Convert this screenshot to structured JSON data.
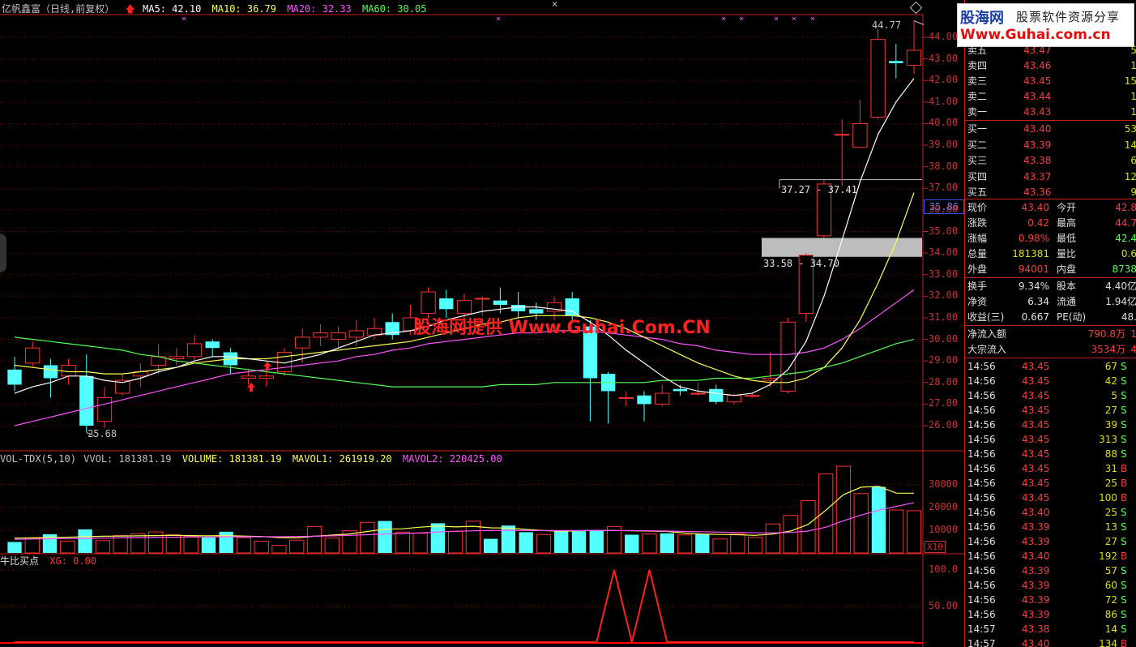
{
  "header": {
    "stock": "亿帆鑫富（日线,前复权）",
    "ma5": "MA5: 42.10",
    "ma10": "MA10: 36.79",
    "ma20": "MA20: 32.33",
    "ma60": "MA60: 30.05"
  },
  "colors": {
    "up": "#ff3232",
    "down": "#54ffff",
    "ma5": "#ffffff",
    "ma10": "#ffff54",
    "ma20": "#ff54ff",
    "ma60": "#54ff54",
    "grid": "#8b0000"
  },
  "icons": [
    "up-arrow-icon",
    "close-icon",
    "restore-icon"
  ],
  "price_axis": [
    "44.00",
    "43.00",
    "42.00",
    "41.00",
    "40.00",
    "39.00",
    "38.00",
    "37.00",
    "36.00",
    "35.00",
    "34.00",
    "33.00",
    "32.00",
    "31.00",
    "30.00",
    "29.00",
    "28.00",
    "27.00",
    "26.00"
  ],
  "current_price_tag": "35.86",
  "annotations": {
    "high": "44.77",
    "low": "25.68",
    "range_upper": "37.27 - 37.41",
    "range_lower": "33.58 - 34.70"
  },
  "watermark": "股海网提供 Www.Guhai.Com.CN",
  "logo": {
    "brand": "股海网",
    "slogan": "股票软件资源分享",
    "url": "Www.Guhai.com.cn"
  },
  "volume_panel": {
    "label": "VOL-TDX(5,10)",
    "vvol": "VVOL: 181381.19",
    "volume": "VOLUME: 181381.19",
    "mavol1": "MAVOL1: 261919.20",
    "mavol2": "MAVOL2: 220425.00",
    "axis": [
      "30000",
      "20000",
      "10000"
    ],
    "unit": "X10"
  },
  "indicator_panel": {
    "name": "牛比买点",
    "xg": "XG: 0.00",
    "axis": [
      "100.0",
      "50.00"
    ]
  },
  "chart_data": {
    "type": "candlestick",
    "ylim": [
      25.0,
      45.5
    ],
    "candles": [
      [
        28.6,
        27.9,
        29.2,
        27.6
      ],
      [
        28.9,
        29.6,
        29.9,
        28.7
      ],
      [
        28.8,
        28.2,
        29.1,
        27.3
      ],
      [
        28.3,
        28.8,
        29.1,
        27.9
      ],
      [
        28.3,
        26.0,
        29.3,
        25.7
      ],
      [
        26.2,
        27.3,
        27.8,
        25.9
      ],
      [
        27.5,
        28.1,
        28.4,
        27.4
      ],
      [
        28.3,
        28.5,
        28.9,
        27.8
      ],
      [
        28.8,
        29.2,
        29.8,
        28.4
      ],
      [
        29.1,
        29.2,
        29.6,
        28.8
      ],
      [
        29.2,
        29.8,
        30.2,
        28.9
      ],
      [
        29.9,
        29.6,
        30.0,
        29.2
      ],
      [
        29.4,
        28.8,
        29.6,
        28.4
      ],
      [
        28.2,
        28.3,
        28.6,
        27.9
      ],
      [
        28.2,
        28.3,
        28.6,
        27.8
      ],
      [
        28.5,
        29.4,
        29.6,
        28.3
      ],
      [
        29.6,
        30.1,
        30.5,
        28.9
      ],
      [
        30.1,
        30.3,
        30.7,
        29.7
      ],
      [
        30.0,
        30.3,
        30.6,
        29.6
      ],
      [
        30.1,
        30.4,
        30.9,
        29.7
      ],
      [
        30.2,
        30.5,
        31.0,
        30.0
      ],
      [
        30.8,
        30.2,
        31.2,
        30.0
      ],
      [
        30.4,
        31.0,
        31.6,
        30.2
      ],
      [
        31.2,
        32.2,
        32.4,
        31.0
      ],
      [
        31.9,
        31.4,
        32.3,
        31.0
      ],
      [
        31.2,
        31.8,
        32.1,
        30.8
      ],
      [
        31.9,
        31.9,
        32.0,
        31.1
      ],
      [
        31.8,
        31.6,
        32.4,
        31.2
      ],
      [
        31.6,
        31.3,
        32.2,
        31.0
      ],
      [
        31.4,
        31.2,
        31.7,
        30.9
      ],
      [
        31.3,
        31.7,
        32.0,
        30.9
      ],
      [
        31.9,
        31.1,
        32.2,
        30.9
      ],
      [
        30.6,
        28.2,
        30.9,
        26.2
      ],
      [
        28.4,
        27.6,
        28.5,
        26.1
      ],
      [
        27.3,
        27.3,
        27.6,
        26.9
      ],
      [
        27.4,
        27.0,
        27.6,
        26.2
      ],
      [
        27.0,
        27.5,
        27.9,
        26.9
      ],
      [
        27.7,
        27.6,
        27.9,
        27.4
      ],
      [
        27.5,
        27.5,
        28.0,
        27.4
      ],
      [
        27.7,
        27.1,
        27.9,
        27.0
      ],
      [
        27.1,
        27.4,
        27.5,
        27.0
      ],
      [
        27.4,
        27.4,
        27.5,
        27.3
      ],
      [
        28.1,
        28.2,
        29.4,
        27.8
      ],
      [
        27.6,
        30.8,
        31.0,
        27.5
      ],
      [
        31.2,
        33.9,
        34.0,
        30.8
      ],
      [
        34.8,
        37.2,
        37.4,
        34.7
      ],
      [
        39.5,
        39.5,
        40.2,
        37.1
      ],
      [
        38.9,
        40.0,
        41.1,
        38.9
      ],
      [
        40.3,
        43.9,
        44.4,
        40.2
      ],
      [
        42.9,
        42.8,
        43.7,
        42.1
      ],
      [
        42.7,
        43.4,
        44.77,
        42.3
      ]
    ],
    "ma5": [
      27.5,
      27.8,
      28.0,
      28.3,
      28.3,
      28.1,
      28.0,
      28.2,
      28.5,
      28.7,
      29.0,
      29.2,
      29.2,
      29.1,
      29.0,
      28.9,
      29.1,
      29.3,
      29.6,
      29.9,
      30.2,
      30.3,
      30.4,
      30.6,
      30.9,
      31.1,
      31.3,
      31.4,
      31.5,
      31.5,
      31.4,
      31.3,
      30.8,
      30.2,
      29.5,
      28.9,
      28.3,
      27.8,
      27.6,
      27.5,
      27.4,
      27.5,
      27.9,
      28.6,
      29.9,
      32.0,
      34.6,
      37.3,
      39.5,
      41.0,
      42.1
    ],
    "ma10": [
      28.8,
      28.7,
      28.6,
      28.5,
      28.5,
      28.4,
      28.4,
      28.5,
      28.6,
      28.7,
      28.9,
      29.0,
      29.1,
      29.1,
      29.1,
      29.2,
      29.3,
      29.4,
      29.5,
      29.6,
      29.7,
      29.8,
      29.9,
      30.1,
      30.3,
      30.5,
      30.7,
      30.8,
      31.0,
      31.1,
      31.1,
      31.1,
      31.0,
      30.8,
      30.5,
      30.1,
      29.7,
      29.3,
      28.9,
      28.6,
      28.3,
      28.1,
      28.0,
      28.0,
      28.2,
      28.7,
      29.6,
      30.9,
      32.6,
      34.5,
      36.8
    ],
    "ma20": [
      26.0,
      26.2,
      26.4,
      26.6,
      26.8,
      27.0,
      27.2,
      27.4,
      27.6,
      27.8,
      28.0,
      28.2,
      28.4,
      28.5,
      28.6,
      28.7,
      28.8,
      28.9,
      29.0,
      29.2,
      29.3,
      29.5,
      29.6,
      29.8,
      29.9,
      30.0,
      30.1,
      30.2,
      30.3,
      30.3,
      30.4,
      30.4,
      30.4,
      30.3,
      30.2,
      30.1,
      30.0,
      29.8,
      29.7,
      29.5,
      29.4,
      29.3,
      29.3,
      29.3,
      29.4,
      29.6,
      30.0,
      30.5,
      31.1,
      31.7,
      32.3
    ],
    "ma60": [
      30.1,
      30.0,
      29.9,
      29.8,
      29.7,
      29.6,
      29.5,
      29.3,
      29.2,
      29.0,
      28.9,
      28.8,
      28.7,
      28.6,
      28.5,
      28.4,
      28.3,
      28.2,
      28.1,
      28.0,
      27.9,
      27.8,
      27.8,
      27.8,
      27.8,
      27.8,
      27.8,
      27.9,
      27.9,
      27.9,
      28.0,
      28.0,
      28.0,
      28.0,
      28.0,
      28.0,
      28.1,
      28.1,
      28.1,
      28.2,
      28.2,
      28.2,
      28.3,
      28.4,
      28.5,
      28.7,
      28.9,
      29.2,
      29.5,
      29.8,
      30.0
    ],
    "volume": {
      "ylim": [
        0,
        38000
      ],
      "values": [
        4800,
        6500,
        8200,
        5200,
        10300,
        5400,
        7600,
        8400,
        9200,
        8000,
        7200,
        6800,
        9300,
        6700,
        5100,
        3300,
        5600,
        11600,
        6500,
        9700,
        13400,
        14000,
        9100,
        8600,
        13000,
        9400,
        13900,
        6200,
        12000,
        9100,
        8100,
        9900,
        9500,
        10000,
        11600,
        8000,
        8300,
        8600,
        7900,
        8200,
        6100,
        8300,
        6800,
        12700,
        16400,
        22900,
        34600,
        38000,
        26000,
        29000,
        18800,
        18500
      ],
      "mavol1": [
        6500,
        6600,
        6800,
        6900,
        7100,
        7300,
        7400,
        7500,
        7600,
        7700,
        7600,
        7500,
        7600,
        7400,
        7200,
        6700,
        6600,
        7300,
        7800,
        8300,
        9400,
        10400,
        10600,
        11300,
        11800,
        11400,
        11700,
        11000,
        10900,
        10300,
        9800,
        9500,
        9700,
        9900,
        9800,
        9700,
        9600,
        9400,
        8700,
        8300,
        8100,
        8000,
        7700,
        8300,
        9600,
        12500,
        18700,
        25500,
        28800,
        29200,
        26200,
        26191
      ],
      "mavol2": [
        6000,
        6100,
        6200,
        6300,
        6400,
        6500,
        6600,
        6700,
        6800,
        6900,
        7000,
        7000,
        7100,
        7100,
        7100,
        7100,
        7200,
        7300,
        7500,
        7700,
        8000,
        8300,
        8500,
        8800,
        9200,
        9500,
        9700,
        9800,
        9900,
        9800,
        9800,
        9800,
        9800,
        9900,
        9800,
        9800,
        9700,
        9600,
        9400,
        9300,
        9100,
        9000,
        8800,
        8800,
        9000,
        9600,
        11300,
        14100,
        16600,
        18700,
        20400,
        22042
      ]
    },
    "indicator": {
      "ylim": [
        0,
        110
      ],
      "values": [
        0,
        0,
        0,
        0,
        0,
        0,
        0,
        0,
        0,
        0,
        0,
        0,
        0,
        0,
        0,
        0,
        0,
        0,
        0,
        0,
        0,
        0,
        0,
        0,
        0,
        0,
        0,
        0,
        0,
        0,
        0,
        0,
        0,
        0,
        100,
        0,
        100,
        0,
        0,
        0,
        0,
        0,
        0,
        0,
        0,
        0,
        0,
        0,
        0,
        0,
        0,
        0
      ]
    }
  },
  "quote": {
    "ask": [
      {
        "label": "卖五",
        "price": "43.47",
        "vol": "5"
      },
      {
        "label": "卖四",
        "price": "43.46",
        "vol": "1"
      },
      {
        "label": "卖三",
        "price": "43.45",
        "vol": "15"
      },
      {
        "label": "卖二",
        "price": "43.44",
        "vol": "1"
      },
      {
        "label": "卖一",
        "price": "43.43",
        "vol": "1"
      }
    ],
    "bid": [
      {
        "label": "买一",
        "price": "43.40",
        "vol": "53"
      },
      {
        "label": "买二",
        "price": "43.39",
        "vol": "14"
      },
      {
        "label": "买三",
        "price": "43.38",
        "vol": "6"
      },
      {
        "label": "买四",
        "price": "43.37",
        "vol": "12"
      },
      {
        "label": "买五",
        "price": "43.36",
        "vol": "9"
      }
    ],
    "info1": [
      {
        "l1": "现价",
        "v1": "43.40",
        "c1": "#ff3b3b",
        "l2": "今开",
        "v2": "42.8",
        "c2": "#ff3b3b"
      },
      {
        "l1": "涨跌",
        "v1": "0.42",
        "c1": "#ff3b3b",
        "l2": "最高",
        "v2": "44.7",
        "c2": "#ff3b3b"
      },
      {
        "l1": "涨幅",
        "v1": "0.98%",
        "c1": "#ff3b3b",
        "l2": "最低",
        "v2": "42.4",
        "c2": "#54ff54"
      },
      {
        "l1": "总量",
        "v1": "181381",
        "c1": "#e0e000",
        "l2": "量比",
        "v2": "0.6",
        "c2": "#e0e000"
      },
      {
        "l1": "外盘",
        "v1": "94001",
        "c1": "#ff3b3b",
        "l2": "内盘",
        "v2": "8738",
        "c2": "#54ff54"
      }
    ],
    "info2": [
      {
        "l1": "换手",
        "v1": "9.34%",
        "c1": "#e0e0e0",
        "l2": "股本",
        "v2": "4.40亿",
        "c2": "#e0e0e0"
      },
      {
        "l1": "净资",
        "v1": "6.34",
        "c1": "#e0e0e0",
        "l2": "流通",
        "v2": "1.94亿",
        "c2": "#e0e0e0"
      },
      {
        "l1": "收益(三)",
        "v1": "0.667",
        "c1": "#e0e0e0",
        "l2": "PE(动)",
        "v2": "48.",
        "c2": "#e0e0e0"
      }
    ],
    "flow": [
      {
        "label": "净流入额",
        "value": "790.8万",
        "extra": "1"
      },
      {
        "label": "大宗流入",
        "value": "3534万",
        "extra": "4"
      }
    ],
    "ticks": [
      {
        "t": "14:56",
        "p": "43.45",
        "n": "67",
        "d": "S"
      },
      {
        "t": "14:56",
        "p": "43.45",
        "n": "42",
        "d": "S"
      },
      {
        "t": "14:56",
        "p": "43.45",
        "n": "5",
        "d": "S"
      },
      {
        "t": "14:56",
        "p": "43.45",
        "n": "27",
        "d": "S"
      },
      {
        "t": "14:56",
        "p": "43.45",
        "n": "39",
        "d": "S"
      },
      {
        "t": "14:56",
        "p": "43.45",
        "n": "313",
        "d": "S"
      },
      {
        "t": "14:56",
        "p": "43.45",
        "n": "88",
        "d": "S"
      },
      {
        "t": "14:56",
        "p": "43.45",
        "n": "31",
        "d": "B"
      },
      {
        "t": "14:56",
        "p": "43.45",
        "n": "25",
        "d": "B"
      },
      {
        "t": "14:56",
        "p": "43.45",
        "n": "100",
        "d": "B"
      },
      {
        "t": "14:56",
        "p": "43.40",
        "n": "25",
        "d": "S"
      },
      {
        "t": "14:56",
        "p": "43.39",
        "n": "13",
        "d": "S"
      },
      {
        "t": "14:56",
        "p": "43.39",
        "n": "27",
        "d": "S"
      },
      {
        "t": "14:56",
        "p": "43.40",
        "n": "192",
        "d": "B"
      },
      {
        "t": "14:56",
        "p": "43.39",
        "n": "57",
        "d": "S"
      },
      {
        "t": "14:56",
        "p": "43.39",
        "n": "60",
        "d": "S"
      },
      {
        "t": "14:56",
        "p": "43.39",
        "n": "72",
        "d": "S"
      },
      {
        "t": "14:56",
        "p": "43.39",
        "n": "86",
        "d": "S"
      },
      {
        "t": "14:57",
        "p": "43.38",
        "n": "14",
        "d": "S"
      },
      {
        "t": "14:57",
        "p": "43.40",
        "n": "134",
        "d": "B"
      }
    ]
  }
}
